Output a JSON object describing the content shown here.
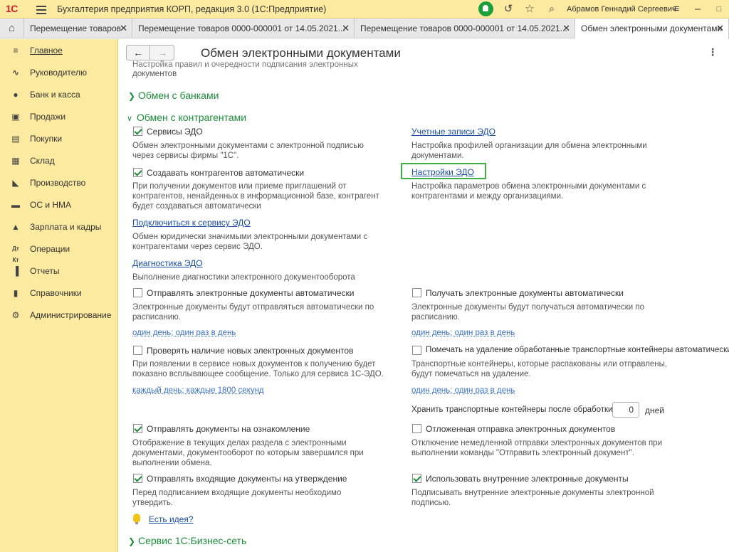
{
  "titlebar": {
    "logo": "1С",
    "app_title": "Бухгалтерия предприятия КОРП, редакция 3.0  (1С:Предприятие)",
    "user": "Абрамов Геннадий Сергеевич"
  },
  "tabs": [
    {
      "label": "Перемещение товаров"
    },
    {
      "label": "Перемещение товаров 0000-000001 от 14.05.2021..."
    },
    {
      "label": "Перемещение товаров 0000-000001 от 14.05.2021..."
    },
    {
      "label": "Обмен электронными документами"
    }
  ],
  "sidebar": {
    "items": [
      {
        "label": "Главное",
        "icon": "menu-icon"
      },
      {
        "label": "Руководителю",
        "icon": "chart-line-icon"
      },
      {
        "label": "Банк и касса",
        "icon": "coin-icon"
      },
      {
        "label": "Продажи",
        "icon": "bag-icon"
      },
      {
        "label": "Покупки",
        "icon": "cart-icon"
      },
      {
        "label": "Склад",
        "icon": "warehouse-icon"
      },
      {
        "label": "Производство",
        "icon": "factory-icon"
      },
      {
        "label": "ОС и НМА",
        "icon": "truck-icon"
      },
      {
        "label": "Зарплата и кадры",
        "icon": "person-icon"
      },
      {
        "label": "Операции",
        "icon": "operations-icon"
      },
      {
        "label": "Отчеты",
        "icon": "bar-chart-icon"
      },
      {
        "label": "Справочники",
        "icon": "book-icon"
      },
      {
        "label": "Администрирование",
        "icon": "gear-icon"
      }
    ]
  },
  "page": {
    "title": "Обмен электронными документами",
    "top_clip_text": "Настройка правил и очередности подписания электронных",
    "top_clip_text2": "документов",
    "section_banks": "Обмен с банками",
    "section_counterparties": "Обмен с контрагентами",
    "section_business_net": "Сервис 1С:Бизнес-сеть",
    "edo_services": {
      "label": "Сервисы ЭДО",
      "hint1": "Обмен электронными документами с электронной подписью",
      "hint2": "через сервисы фирмы \"1С\"."
    },
    "edo_accounts": {
      "label": "Учетные записи ЭДО",
      "hint1": "Настройка профилей организации для обмена электронными",
      "hint2": "документами."
    },
    "create_counterparties": {
      "label": "Создавать контрагентов автоматически",
      "hint1": "При получении документов или приеме приглашений от",
      "hint2": "контрагентов, ненайденных в информационной базе, контрагент",
      "hint3": "будет создаваться автоматически"
    },
    "edo_settings": {
      "label": "Настройки ЭДО",
      "hint1": "Настройка параметров обмена электронными документами с",
      "hint2": "контрагентами и между организациями."
    },
    "connect_service": {
      "label": "Подключиться к сервису ЭДО",
      "hint1": "Обмен юридически значимыми электронными документами с",
      "hint2": "контрагентами через сервис ЭДО."
    },
    "diagnostics": {
      "label": "Диагностика ЭДО",
      "hint1": "Выполнение диагностики электронного документооборота"
    },
    "send_auto": {
      "label": "Отправлять электронные документы автоматически",
      "hint1": "Электронные документы будут отправляться автоматически по",
      "hint2": "расписанию.",
      "schedule": "один день; один раз в день"
    },
    "receive_auto": {
      "label": "Получать электронные документы автоматически",
      "hint1": "Электронные документы будут получаться автоматически по",
      "hint2": "расписанию.",
      "schedule": "один день; один раз в день"
    },
    "check_new": {
      "label": "Проверять наличие новых электронных документов",
      "hint1": "При появлении в сервисе новых документов к получению будет",
      "hint2": "показано всплывающее сообщение. Только для сервиса 1С-ЭДО.",
      "schedule": "каждый день; каждые 1800 секунд"
    },
    "mark_delete": {
      "label": "Помечать на удаление обработанные транспортные контейнеры автоматически",
      "hint1": "Транспортные контейнеры, которые распакованы или отправлены,",
      "hint2": "будут помечаться на удаление.",
      "schedule": "один день; один раз в день"
    },
    "keep_containers": {
      "label": "Хранить транспортные контейнеры после обработки:",
      "value": "0",
      "unit": "дней"
    },
    "send_review": {
      "label": "Отправлять документы на ознакомление",
      "hint1": "Отображение в текущих делах  раздела с электронными",
      "hint2": "документами, документооборот по которым завершился при",
      "hint3": "выполнении обмена."
    },
    "delayed_send": {
      "label": "Отложенная отправка электронных документов",
      "hint1": "Отключение немедленной отправки электронных документов при",
      "hint2": "выполнении команды \"Отправить электронный документ\"."
    },
    "send_incoming": {
      "label": "Отправлять входящие документы на утверждение",
      "hint1": "Перед подписанием входящие документы необходимо",
      "hint2": "утвердить."
    },
    "use_internal": {
      "label": "Использовать внутренние электронные документы",
      "hint1": "Подписывать внутренние электронные документы электронной",
      "hint2": "подписью."
    },
    "idea_link": "Есть идея?"
  },
  "colors": {
    "accent_green": "#1c8c3a",
    "header_yellow": "#fbeaa0",
    "link_blue": "#1a4fa0"
  }
}
